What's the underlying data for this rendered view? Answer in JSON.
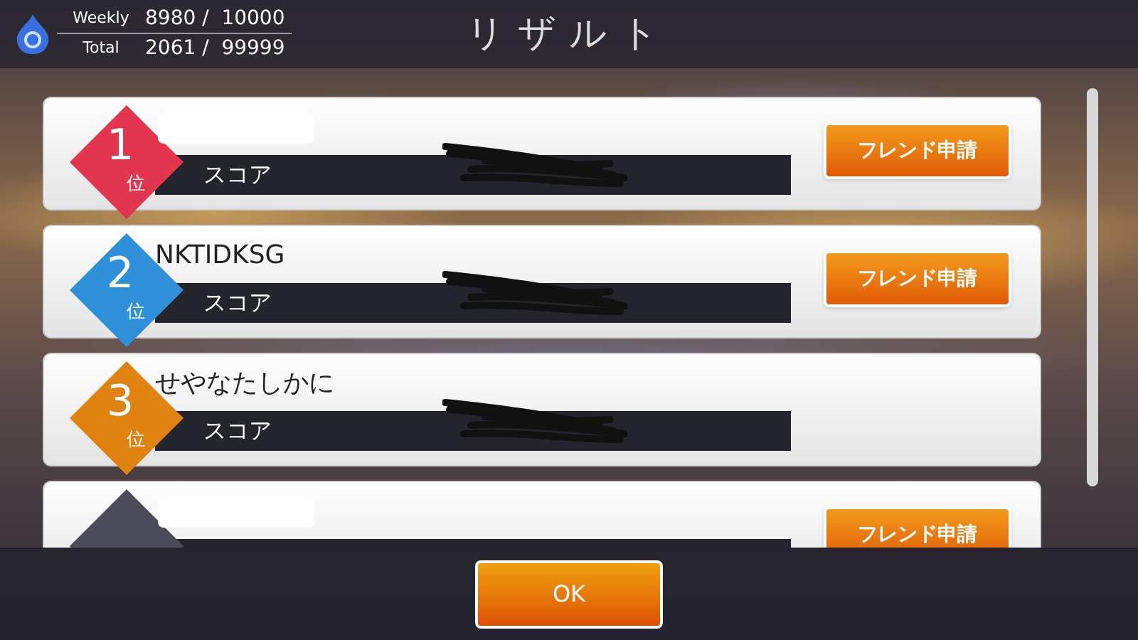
{
  "header": {
    "stats": [
      {
        "label": "Weekly",
        "value": "8980 /  10000"
      },
      {
        "label": "Total",
        "value": "2061 /  99999"
      }
    ],
    "title": "リザルト"
  },
  "results": [
    {
      "rank": "1",
      "suffix": "位",
      "color": "#e2364f",
      "name_redacted": true,
      "score_label": "スコア",
      "friend_button": "フレンド申請"
    },
    {
      "rank": "2",
      "suffix": "位",
      "color": "#2f8fd8",
      "name": "NKTIDKSG",
      "score_label": "スコア",
      "friend_button": "フレンド申請"
    },
    {
      "rank": "3",
      "suffix": "位",
      "color": "#e0820f",
      "name": "せやなたしかに",
      "score_label": "スコア"
    },
    {
      "color": "#4b4b5a",
      "name_redacted": true,
      "friend_button": "フレンド申請"
    }
  ],
  "ok_button": "OK"
}
